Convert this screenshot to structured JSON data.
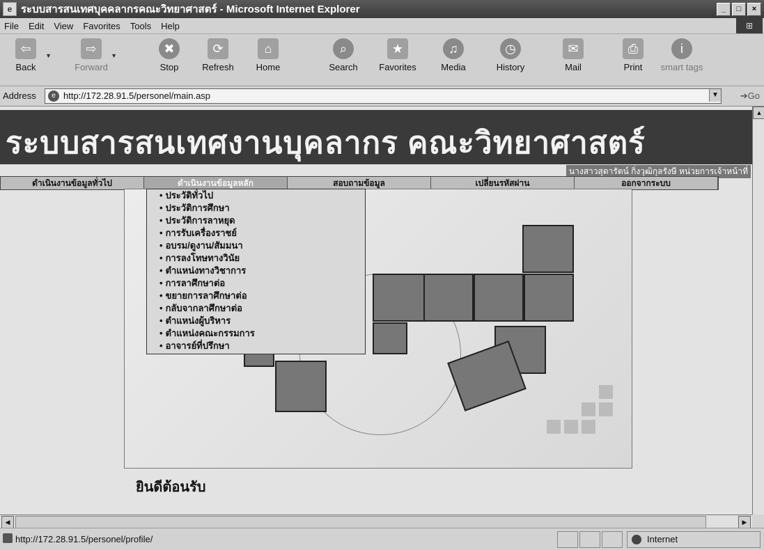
{
  "window": {
    "title": "ระบบสารสนเทศบุคคลากรคณะวิทยาศาสตร์ - Microsoft Internet Explorer"
  },
  "menubar": [
    "File",
    "Edit",
    "View",
    "Favorites",
    "Tools",
    "Help"
  ],
  "toolbar": [
    {
      "label": "Back",
      "icon": "back-arrow-icon"
    },
    {
      "label": "Forward",
      "icon": "forward-arrow-icon"
    },
    {
      "label": "Stop",
      "icon": "stop-icon"
    },
    {
      "label": "Refresh",
      "icon": "refresh-icon"
    },
    {
      "label": "Home",
      "icon": "home-icon"
    },
    {
      "label": "Search",
      "icon": "search-icon"
    },
    {
      "label": "Favorites",
      "icon": "favorites-icon"
    },
    {
      "label": "Media",
      "icon": "media-icon"
    },
    {
      "label": "History",
      "icon": "history-icon"
    },
    {
      "label": "Mail",
      "icon": "mail-icon"
    },
    {
      "label": "Print",
      "icon": "print-icon"
    },
    {
      "label": "smart tags",
      "icon": "info-icon"
    }
  ],
  "address": {
    "label": "Address",
    "url": "http://172.28.91.5/personel/main.asp",
    "go": "Go"
  },
  "page": {
    "banner_title": "ระบบสารสนเทศงานบุคลากร คณะวิทยาศาสตร์",
    "user_line": "นางสาวสุดารัตน์ กิ่งวุฒิกุลรังษี หน่วยการเจ้าหน้าที่",
    "nav": [
      "ดำเนินงานข้อมูลทั่วไป",
      "ดำเนินงานข้อมูลหลัก",
      "สอบถามข้อมูล",
      "เปลี่ยนรหัสผ่าน",
      "ออกจากระบบ"
    ],
    "submenu": [
      "ประวัติทั่วไป",
      "ประวัติการศึกษา",
      "ประวัติการลาหยุด",
      "การรับเครื่องราชย์",
      "อบรม/ดูงาน/สัมมนา",
      "การลงโทษทางวินัย",
      "ตำแหน่งทางวิชาการ",
      "การลาศึกษาต่อ",
      "ขยายการลาศึกษาต่อ",
      "กลับจากลาศึกษาต่อ",
      "ตำแหน่งผู้บริหาร",
      "ตำแหน่งคณะกรรมการ",
      "อาจารย์ที่ปรึกษา"
    ],
    "welcome": "ยินดีต้อนรับ"
  },
  "status": {
    "text": "http://172.28.91.5/personel/profile/",
    "zone": "Internet"
  }
}
